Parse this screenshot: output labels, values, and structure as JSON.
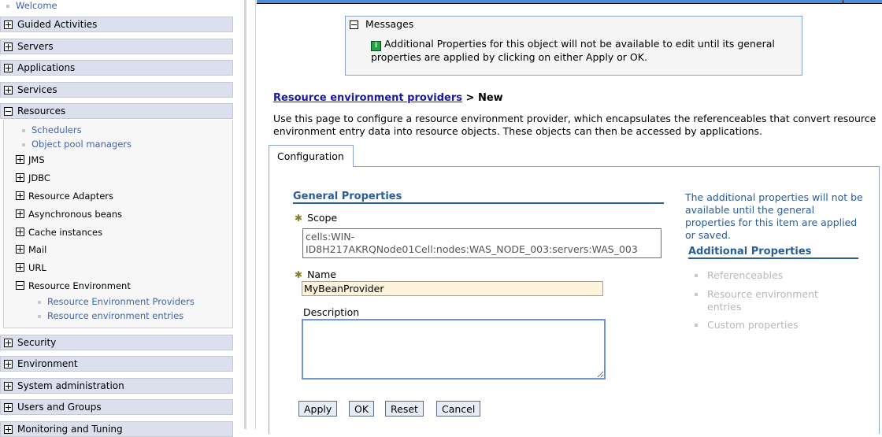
{
  "sidebar": {
    "welcome": "Welcome",
    "categories": [
      {
        "label": "Guided Activities",
        "expanded": false
      },
      {
        "label": "Servers",
        "expanded": false
      },
      {
        "label": "Applications",
        "expanded": false
      },
      {
        "label": "Services",
        "expanded": false
      },
      {
        "label": "Resources",
        "expanded": true
      },
      {
        "label": "Security",
        "expanded": false
      },
      {
        "label": "Environment",
        "expanded": false
      },
      {
        "label": "System administration",
        "expanded": false
      },
      {
        "label": "Users and Groups",
        "expanded": false
      },
      {
        "label": "Monitoring and Tuning",
        "expanded": false
      }
    ],
    "resources": {
      "links": [
        "Schedulers",
        "Object pool managers"
      ],
      "nodes": [
        "JMS",
        "JDBC",
        "Resource Adapters",
        "Asynchronous beans",
        "Cache instances",
        "Mail",
        "URL"
      ],
      "resource_environment": {
        "label": "Resource Environment",
        "links": [
          "Resource Environment Providers",
          "Resource environment entries"
        ]
      }
    }
  },
  "main": {
    "titlebar": "Resource environment providers",
    "messages": {
      "title": "Messages",
      "text": "Additional Properties for this object will not be available to edit until its general properties are applied by clicking on either Apply or OK."
    },
    "breadcrumb": {
      "link": "Resource environment providers",
      "separator": " > ",
      "current": "New"
    },
    "intro": "Use this page to configure a resource environment provider, which encapsulates the referenceables that convert resource environment entry data into resource objects. These objects can then be accessed by applications.",
    "tab": "Configuration",
    "general_properties": {
      "heading": "General Properties",
      "scope_label": "Scope",
      "scope_value_line1": "cells:WIN-",
      "scope_value_line2": "ID8H217AKRQNode01Cell:nodes:WAS_NODE_003:servers:WAS_003",
      "name_label": "Name",
      "name_value": "MyBeanProvider",
      "description_label": "Description",
      "description_value": ""
    },
    "buttons": {
      "apply": "Apply",
      "ok": "OK",
      "reset": "Reset",
      "cancel": "Cancel"
    },
    "additional": {
      "note": "The additional properties will not be available until the general properties for this item are applied or saved.",
      "heading": "Additional Properties",
      "items": [
        "Referenceables",
        "Resource environment entries",
        "Custom properties"
      ]
    }
  }
}
